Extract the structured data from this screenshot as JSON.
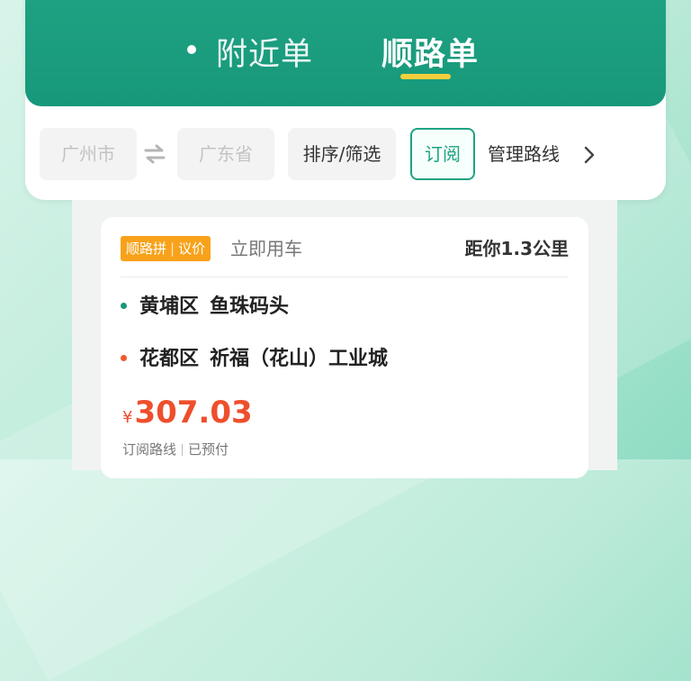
{
  "tabs": {
    "nearby": "附近单",
    "route": "顺路单"
  },
  "filters": {
    "from_city": "广州市",
    "to_city": "广东省",
    "sort_filter": "排序/筛选",
    "subscribe": "订阅",
    "manage_routes": "管理路线"
  },
  "order": {
    "tag_type": "顺路拼",
    "tag_price": "议价",
    "timing": "立即用车",
    "distance": "距你1.3公里",
    "from": {
      "district": "黄埔区",
      "place": "鱼珠码头"
    },
    "to": {
      "district": "花都区",
      "place": "祈福（花山）工业城"
    },
    "currency": "¥",
    "price": "307.03",
    "meta_route": "订阅路线",
    "meta_paid": "已预付"
  },
  "colors": {
    "brand": "#17987a",
    "accent": "#f4cf3d",
    "price": "#ee4f2c",
    "tag": "#f7a21a"
  },
  "icons": [
    "swap-icon",
    "chevron-right-icon"
  ]
}
